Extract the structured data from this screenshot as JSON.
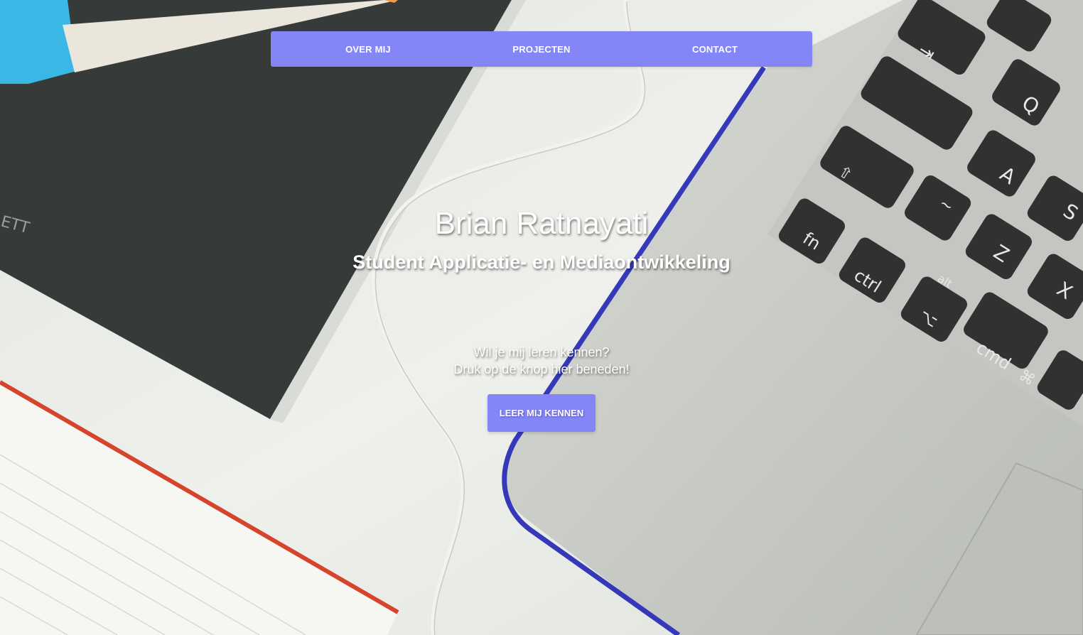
{
  "nav": {
    "items": [
      {
        "label": "OVER MIJ"
      },
      {
        "label": "PROJECTEN"
      },
      {
        "label": "CONTACT"
      }
    ]
  },
  "hero": {
    "title": "Brian Ratnayati",
    "subtitle": "Student Applicatie- en Mediaontwikkeling",
    "question_line1": "Wil je mij leren kennen?",
    "question_line2": "Druk op de knop hier beneden!",
    "cta_label": "LEER MIJ KENNEN"
  },
  "background": {
    "keys": [
      "fn",
      "ctrl",
      "alt",
      "cmd",
      "Q",
      "A",
      "S",
      "Z",
      "X",
      "~",
      "⌥",
      "⌘",
      "⇥"
    ]
  },
  "colors": {
    "accent": "#8486f8",
    "text": "#ffffff"
  }
}
